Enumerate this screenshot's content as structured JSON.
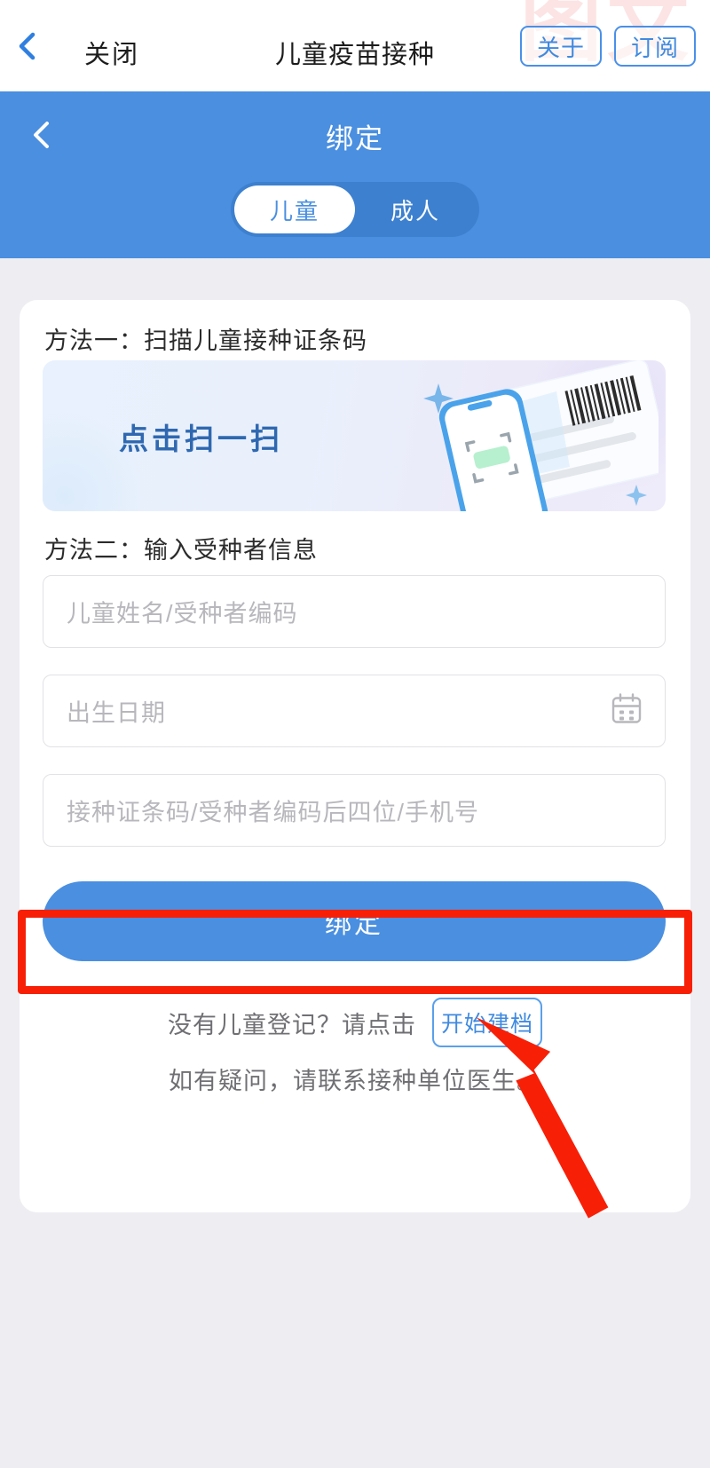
{
  "browser_bar": {
    "back_icon": "chevron-left-icon",
    "close_label": "关闭",
    "page_title": "儿童疫苗接种",
    "about_label": "关于",
    "subscribe_label": "订阅",
    "watermark_text": "图文"
  },
  "app_header": {
    "back_icon": "chevron-left-icon",
    "title": "绑定",
    "segments": [
      {
        "label": "儿童",
        "active": true
      },
      {
        "label": "成人",
        "active": false
      }
    ]
  },
  "card": {
    "method_one_label": "方法一：扫描儿童接种证条码",
    "scan_banner": {
      "action_text": "点击扫一扫",
      "art_name": "phone-scanning-barcode-card-illustration"
    },
    "method_two_label": "方法二：输入受种者信息",
    "fields": [
      {
        "name": "child-name-or-code",
        "placeholder": "儿童姓名/受种者编码",
        "value": "",
        "icon": ""
      },
      {
        "name": "birth-date",
        "placeholder": "出生日期",
        "value": "",
        "icon": "calendar-icon"
      },
      {
        "name": "barcode-or-phone",
        "placeholder": "接种证条码/受种者编码后四位/手机号",
        "value": "",
        "icon": ""
      }
    ],
    "bind_button_label": "绑定",
    "register_prompt": "没有儿童登记？请点击",
    "register_button_label": "开始建档",
    "help_text": "如有疑问，请联系接种单位医生。"
  },
  "annotations": {
    "highlight_target": "bind-button",
    "arrow_target": "register-button",
    "color": "#f81f07"
  },
  "colors": {
    "brand_blue": "#4a8fe0",
    "header_blue": "#4a8fe0",
    "segment_track": "#3d80cf",
    "page_background": "#eeeef2",
    "card_background": "#ffffff",
    "placeholder_gray": "#b7b7bc",
    "annotation_red": "#f81f07",
    "link_blue": "#3f8ae0"
  }
}
